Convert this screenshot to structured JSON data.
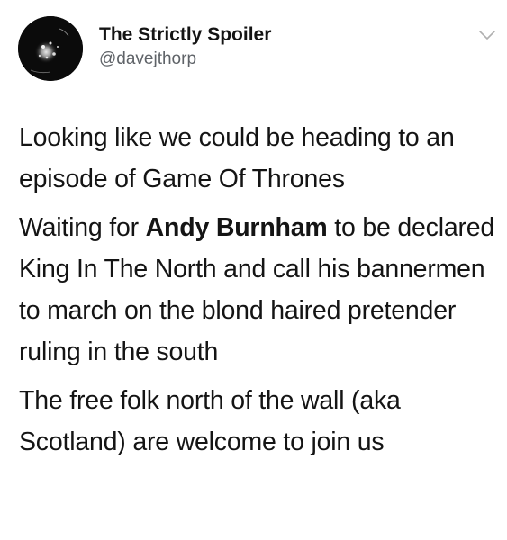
{
  "account": {
    "display_name": "The Strictly Spoiler",
    "handle": "@davejthorp"
  },
  "icons": {
    "menu": "chevron-down-icon",
    "avatar": "avatar"
  },
  "tweet": {
    "para1": "Looking like we could be heading to an episode of Game Of Thrones",
    "para2_prefix": "Waiting for ",
    "para2_mention": "Andy Burnham",
    "para2_suffix": " to be declared King In The North and call his bannermen to march on the blond haired pretender ruling in the south",
    "para3": "The free folk north of the wall (aka Scotland) are welcome to join us"
  },
  "colors": {
    "text": "#141414",
    "handle": "#5f6368",
    "chevron": "#b0b0b0"
  }
}
